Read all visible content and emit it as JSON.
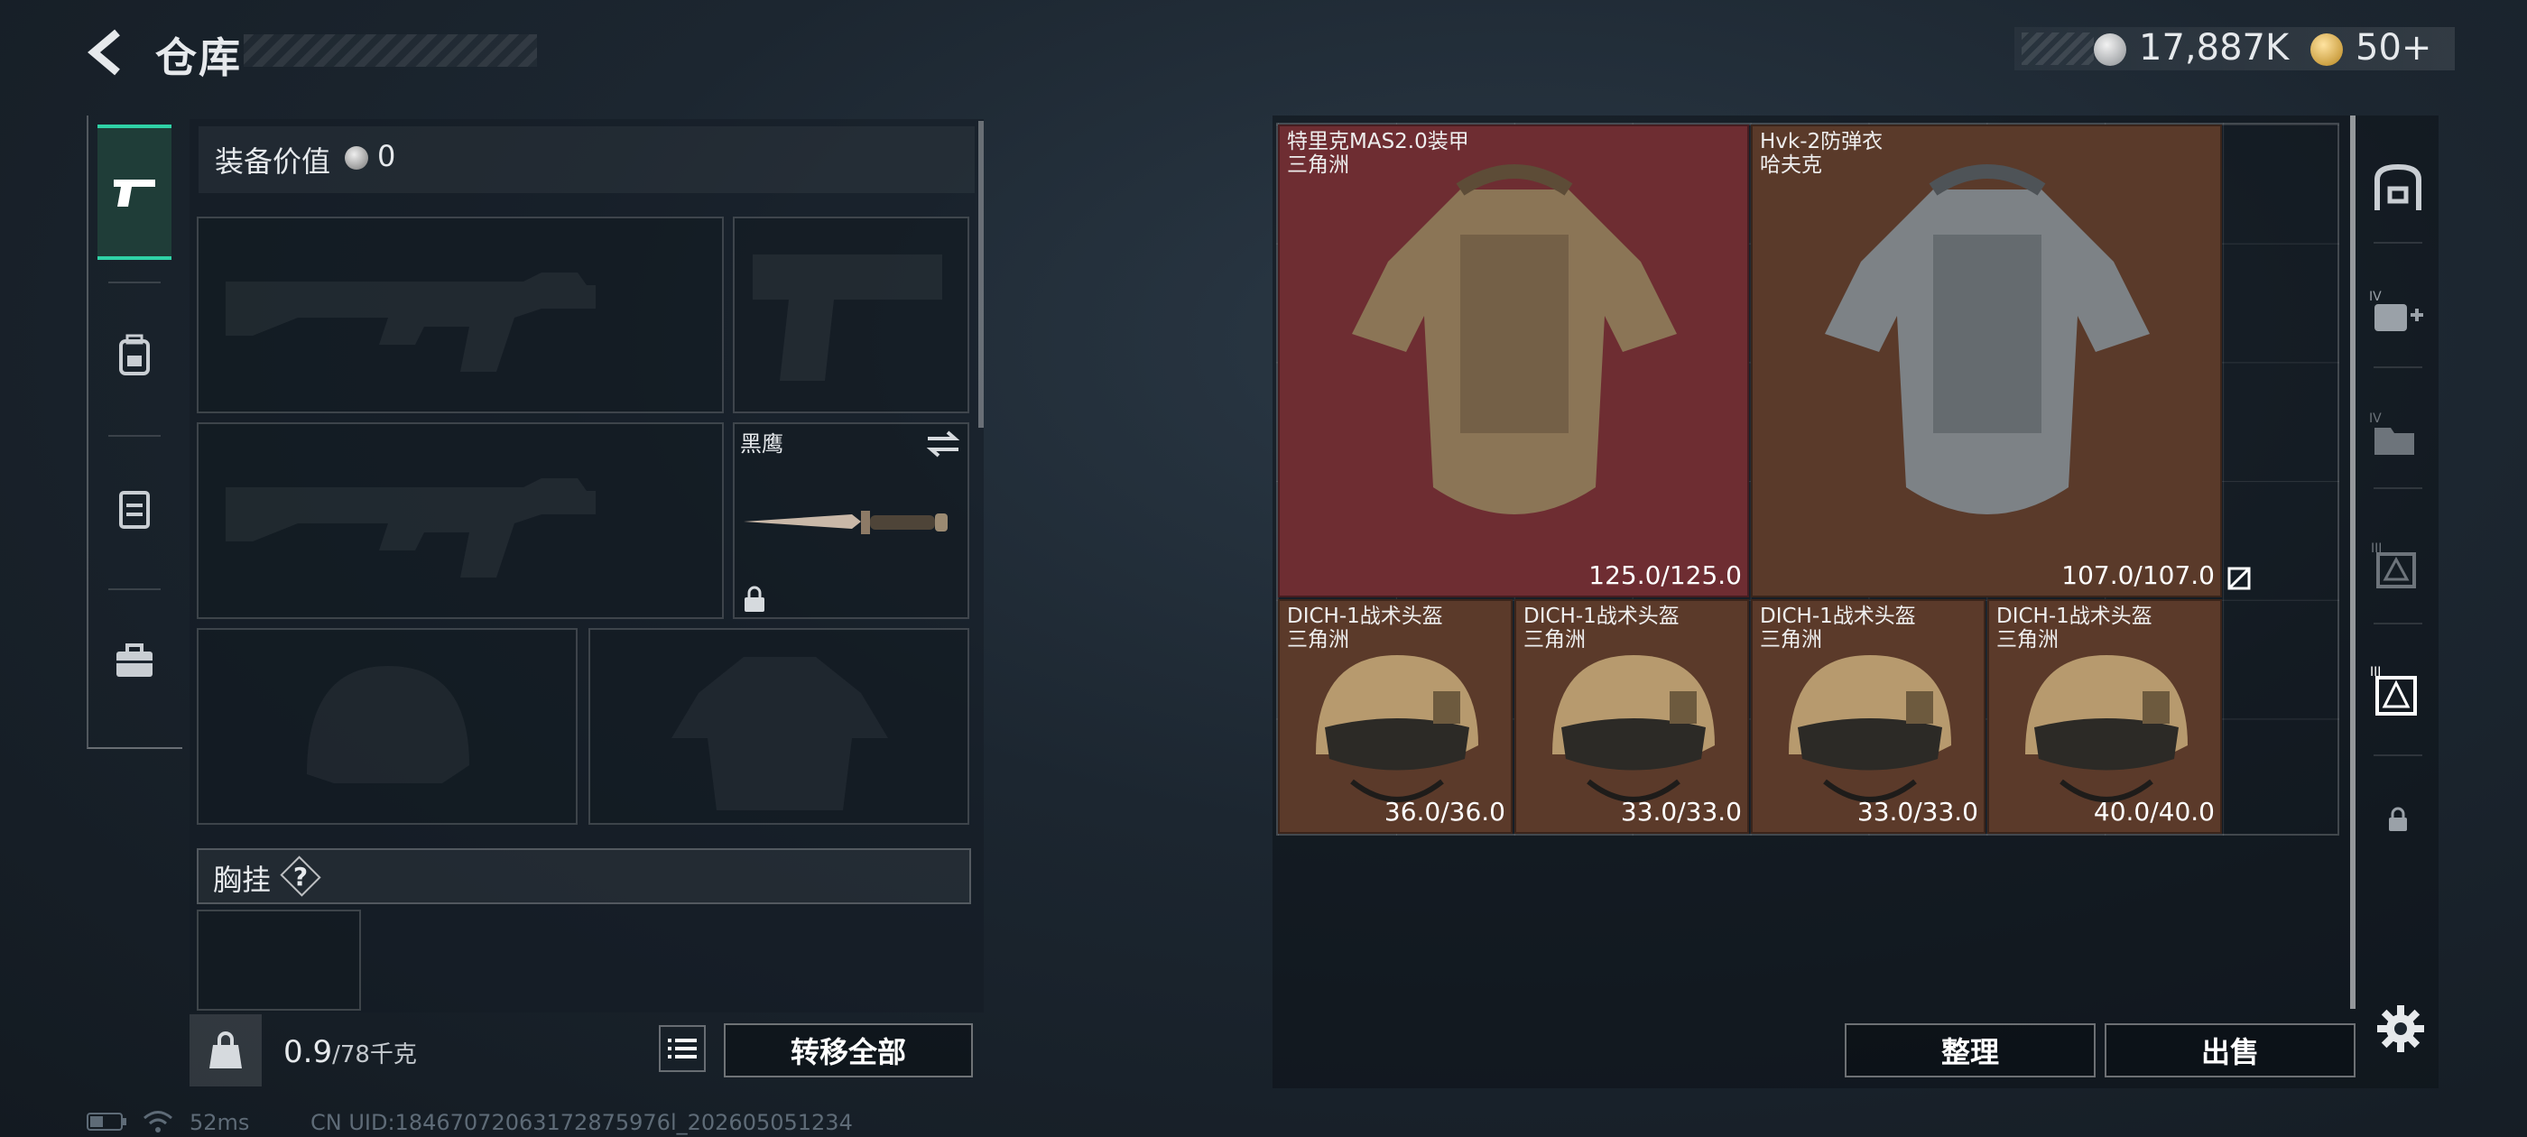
{
  "header": {
    "title": "仓库",
    "currency_money": "17,887K",
    "currency_points": "50+"
  },
  "equipment": {
    "value_label": "装备价值",
    "value": "0",
    "knife_name": "黑鹰",
    "chest_rig_label": "胸挂",
    "help_symbol": "?"
  },
  "footer": {
    "weight_current": "0.9",
    "weight_max": "/78千克",
    "transfer_all": "转移全部",
    "organize": "整理",
    "sell": "出售"
  },
  "status": {
    "ping": "52ms",
    "uid": "CN UID:18467072063172875976l_202605051234"
  },
  "storage_items": [
    {
      "name": "特里克MAS2.0装甲",
      "origin": "三角洲",
      "durability": "125.0/125.0",
      "kind": "armor",
      "color": "#6e2d32"
    },
    {
      "name": "Hvk-2防弹衣",
      "origin": "哈夫克",
      "durability": "107.0/107.0",
      "kind": "armor",
      "color": "#5a3a2a"
    },
    {
      "name": "DICH-1战术头盔",
      "origin": "三角洲",
      "durability": "36.0/36.0",
      "kind": "helmet",
      "color": "#5b3a2a"
    },
    {
      "name": "DICH-1战术头盔",
      "origin": "三角洲",
      "durability": "33.0/33.0",
      "kind": "helmet",
      "color": "#5b3a2a"
    },
    {
      "name": "DICH-1战术头盔",
      "origin": "三角洲",
      "durability": "33.0/33.0",
      "kind": "helmet",
      "color": "#5b3a2a"
    },
    {
      "name": "DICH-1战术头盔",
      "origin": "三角洲",
      "durability": "40.0/40.0",
      "kind": "helmet",
      "color": "#5b3a2a"
    }
  ],
  "icons": {
    "back": "chevron-left-icon",
    "pistol": "pistol-icon",
    "backpack": "backpack-icon",
    "rig": "rig-icon",
    "briefcase": "briefcase-icon",
    "lock": "lock-icon",
    "swap": "swap-icon",
    "list": "list-icon",
    "settings": "gear-icon"
  }
}
